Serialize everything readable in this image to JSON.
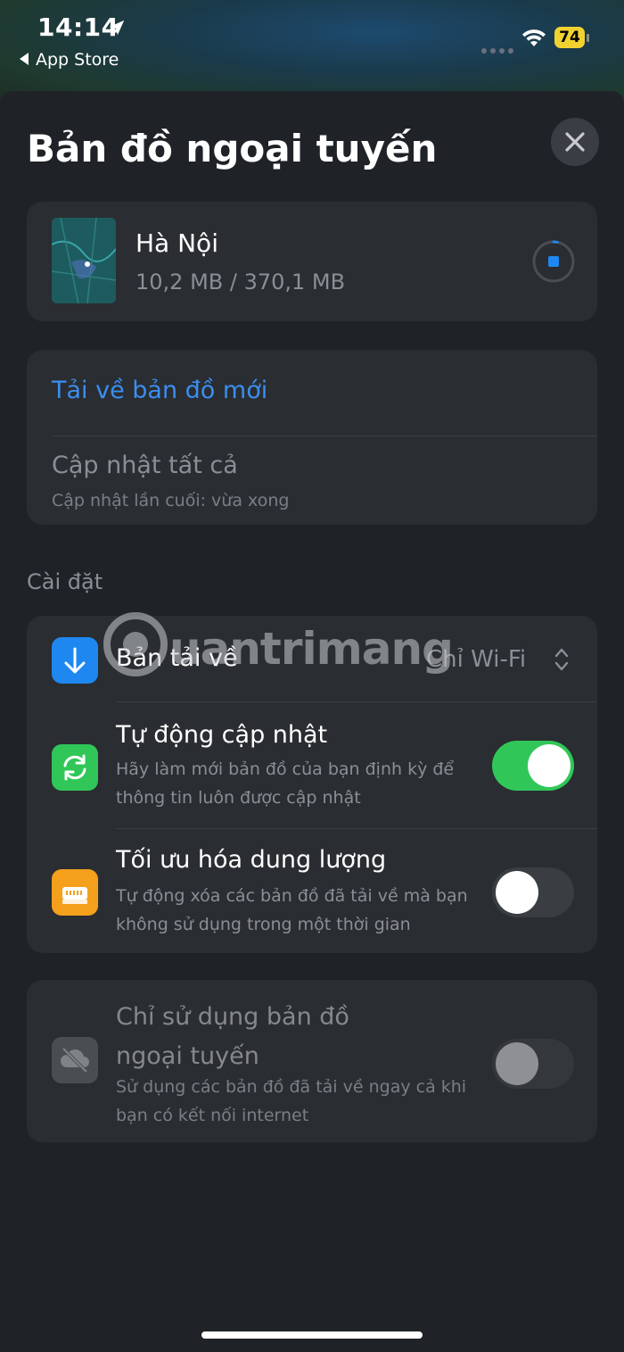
{
  "status_bar": {
    "time": "14:14",
    "back_app": "App Store",
    "battery": "74",
    "location_icon": "location-arrow-icon",
    "wifi_icon": "wifi-icon"
  },
  "sheet": {
    "title": "Bản đồ ngoại tuyến",
    "close_icon": "close-icon"
  },
  "downloaded_map": {
    "city": "Hà Nội",
    "size": "10,2 MB / 370,1 MB",
    "progress_fraction": 0.03,
    "stop_icon": "stop-download-icon"
  },
  "actions": {
    "download_new": "Tải về bản đồ mới",
    "update_all": "Cập nhật tất cả",
    "last_updated": "Cập nhật lần cuối: vừa xong"
  },
  "settings": {
    "section_title": "Cài đặt",
    "downloads": {
      "label": "Bản tải về",
      "value": "Chỉ Wi-Fi",
      "icon": "download-arrow-icon",
      "icon_color": "#1e88f0"
    },
    "auto_update": {
      "label": "Tự động cập nhật",
      "description": "Hãy làm mới bản đồ của bạn định kỳ để thông tin luôn được cập nhật",
      "enabled": true,
      "icon": "refresh-icon",
      "icon_color": "#30c758"
    },
    "optimize_storage": {
      "label": "Tối ưu hóa dung lượng",
      "description": "Tự động xóa các bản đồ đã tải về mà bạn không sử dụng trong một thời gian",
      "enabled": false,
      "icon": "storage-drive-icon",
      "icon_color": "#f4a01c"
    }
  },
  "offline_only": {
    "label": "Chỉ sử dụng bản đồ ngoại tuyến",
    "description": "Sử dụng các bản đồ đã tải về ngay cả khi bạn có kết nối internet",
    "enabled": false,
    "disabled": true,
    "icon": "cloud-off-icon"
  },
  "watermark": {
    "text": "uantrimang"
  },
  "colors": {
    "accent_blue": "#3b8ef0",
    "toggle_on": "#30c758",
    "battery": "#f2d230"
  }
}
